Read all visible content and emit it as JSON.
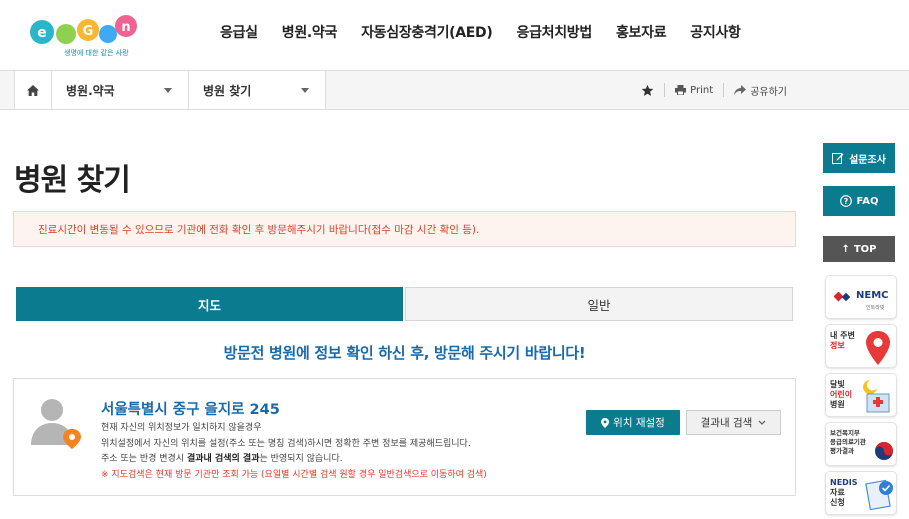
{
  "header": {
    "logo_text": "e-Gen",
    "logo_sub": "생명에 대한 같은 사랑",
    "nav": [
      "응급실",
      "병원.약국",
      "자동심장충격기(AED)",
      "응급처치방법",
      "홍보자료",
      "공지사항"
    ]
  },
  "breadcrumb": {
    "level1": "병원.약국",
    "level2": "병원 찾기",
    "print": "Print",
    "share": "공유하기"
  },
  "page": {
    "title": "병원 찾기",
    "notice": "진료시간이 변동될 수 있으므로 기관에 전화 확인 후 방문해주시기 바랍니다(접수 마감 시간 확인 등).",
    "tabs": [
      "지도",
      "일반"
    ],
    "visit_msg": "방문전 병원에 정보 확인 하신 후, 방문해 주시기 바랍니다!"
  },
  "location": {
    "address": "서울특별시 중구 을지로 245",
    "line1": "현재 자신의 위치정보가 일치하지 않을경우",
    "line2": "위치설정에서 자신의 위치를 설정(주소 또는 명칭 검색)하시면 정확한 주변 정보를 제공해드립니다.",
    "line3_a": "주소 또는 반경 변경시 ",
    "line3_b": "결과내 검색의 결과",
    "line3_c": "는 반영되지 않습니다.",
    "warning": "※ 지도검색은 현재 방문 기관만 조회 가능 (요일별 시간별 검색 원할 경우 일반검색으로 이동하여 검색)",
    "btn_reset": "위치 재설정",
    "btn_search": "결과내 검색"
  },
  "side": {
    "survey": "설문조사",
    "faq": "FAQ",
    "top": "TOP",
    "nemc": "NEMC",
    "nemc_sub": "인트라넷",
    "near": [
      "내 주변",
      "정보"
    ],
    "night": [
      "달빛",
      "어린이",
      "병원"
    ],
    "mohw": [
      "보건복지부",
      "응급의료기관",
      "평가결과"
    ],
    "nedis": [
      "NEDIS",
      "자료",
      "신청"
    ]
  },
  "colors": {
    "teal": "#0b7b8f",
    "blue_text": "#1b6aa8",
    "notice_red": "#d6442a"
  }
}
